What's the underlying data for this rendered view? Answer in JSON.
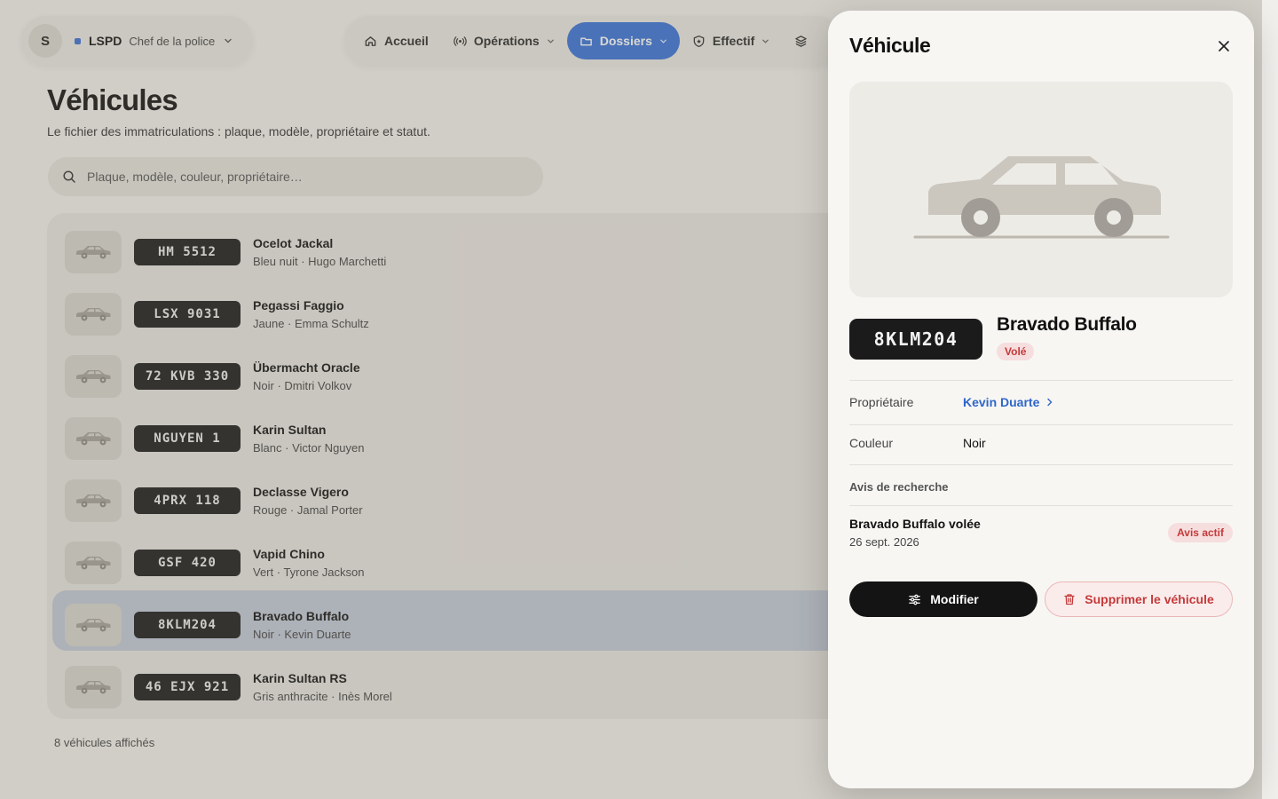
{
  "org": {
    "avatar_letter": "S",
    "name": "LSPD",
    "role": "Chef de la police"
  },
  "nav": {
    "items": [
      {
        "label": "Accueil",
        "icon": "home-icon"
      },
      {
        "label": "Opérations",
        "icon": "broadcast-icon"
      },
      {
        "label": "Dossiers",
        "icon": "folder-icon",
        "active": true
      },
      {
        "label": "Effectif",
        "icon": "badge-icon"
      }
    ]
  },
  "page": {
    "title": "Véhicules",
    "subtitle": "Le fichier des immatriculations : plaque, modèle, propriétaire et statut.",
    "search_placeholder": "Plaque, modèle, couleur, propriétaire…",
    "count_label": "8 véhicules affichés"
  },
  "vehicles": [
    {
      "plate": "HM 5512",
      "model": "Ocelot Jackal",
      "meta": "Bleu nuit · Hugo Marchetti"
    },
    {
      "plate": "LSX 9031",
      "model": "Pegassi Faggio",
      "meta": "Jaune · Emma Schultz"
    },
    {
      "plate": "72 KVB 330",
      "model": "Übermacht Oracle",
      "meta": "Noir · Dmitri Volkov"
    },
    {
      "plate": "NGUYEN 1",
      "model": "Karin Sultan",
      "meta": "Blanc · Victor Nguyen"
    },
    {
      "plate": "4PRX 118",
      "model": "Declasse Vigero",
      "meta": "Rouge · Jamal Porter"
    },
    {
      "plate": "GSF 420",
      "model": "Vapid Chino",
      "meta": "Vert · Tyrone Jackson"
    },
    {
      "plate": "8KLM204",
      "model": "Bravado Buffalo",
      "meta": "Noir · Kevin Duarte",
      "selected": true
    },
    {
      "plate": "46 EJX 921",
      "model": "Karin Sultan RS",
      "meta": "Gris anthracite · Inès Morel"
    }
  ],
  "drawer": {
    "title": "Véhicule",
    "plate": "8KLM204",
    "name": "Bravado Buffalo",
    "status": "Volé",
    "owner_label": "Propriétaire",
    "owner_value": "Kevin Duarte",
    "color_label": "Couleur",
    "color_value": "Noir",
    "notices_heading": "Avis de recherche",
    "notice": {
      "title": "Bravado Buffalo volée",
      "date": "26 sept. 2026",
      "badge": "Avis actif"
    },
    "edit_label": "Modifier",
    "delete_label": "Supprimer le véhicule"
  },
  "colors": {
    "accent": "#3a72d8",
    "danger": "#c43a3a",
    "danger_bg": "#f6dede",
    "link": "#2f66c9",
    "plate_bg": "#1b1b1b"
  }
}
